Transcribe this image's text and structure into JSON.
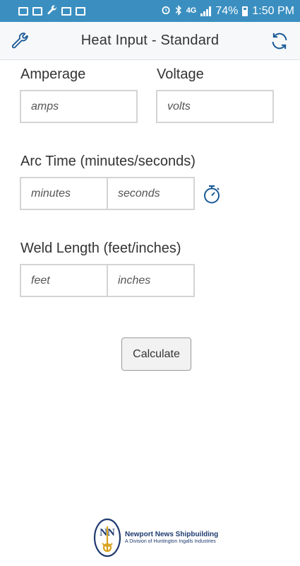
{
  "statusbar": {
    "network": "4G",
    "battery": "74%",
    "time": "1:50 PM",
    "icons": [
      "gmail-icon",
      "gmail-icon",
      "wrench-icon",
      "email-icon",
      "calendar-icon",
      "alarm-icon",
      "bluetooth-icon",
      "signal-icon",
      "battery-icon"
    ]
  },
  "header": {
    "title": "Heat Input - Standard",
    "left_icon": "wrench-icon",
    "right_icon": "refresh-icon"
  },
  "form": {
    "amperage": {
      "label": "Amperage",
      "placeholder": "amps"
    },
    "voltage": {
      "label": "Voltage",
      "placeholder": "volts"
    },
    "arc_time": {
      "label": "Arc Time (minutes/seconds)",
      "minutes_placeholder": "minutes",
      "seconds_placeholder": "seconds",
      "icon": "timer-icon"
    },
    "weld_length": {
      "label": "Weld Length (feet/inches)",
      "feet_placeholder": "feet",
      "inches_placeholder": "inches"
    },
    "calculate_label": "Calculate"
  },
  "footer": {
    "logo_monogram": "NN",
    "company": "Newport News Shipbuilding",
    "subtitle": "A Division of Huntington Ingalls Industries"
  },
  "colors": {
    "statusbar": "#3a8fc0",
    "accent": "#1a5a96",
    "logo_navy": "#1e3a6e",
    "logo_gold": "#d8a21b"
  }
}
